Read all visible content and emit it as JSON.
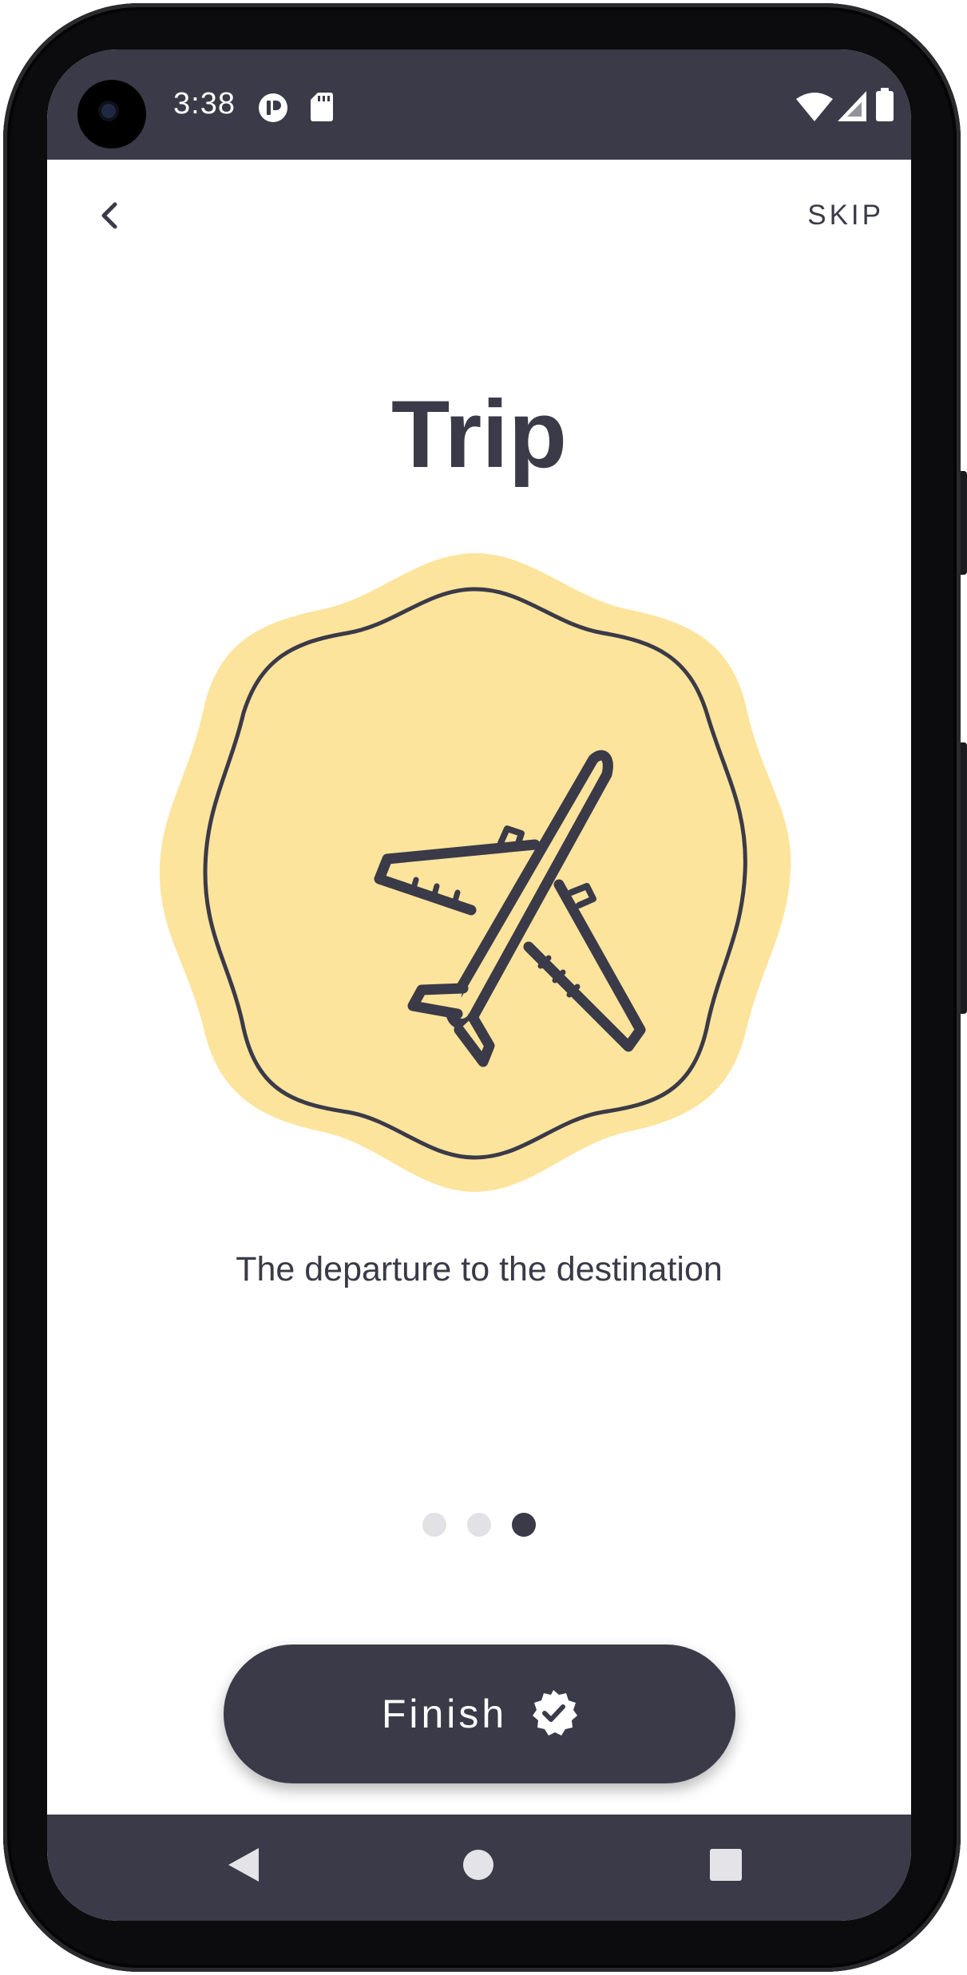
{
  "status_bar": {
    "time": "3:38",
    "icons": [
      "app-notification-icon",
      "sd-card-icon",
      "wifi-icon",
      "cell-signal-icon",
      "battery-icon"
    ]
  },
  "header": {
    "back_icon": "chevron-left-icon",
    "skip_label": "SKIP"
  },
  "onboarding": {
    "title": "Trip",
    "illustration": "airplane-badge",
    "subtitle": "The departure to the destination",
    "page_count": 3,
    "active_page": 3
  },
  "actions": {
    "finish_label": "Finish",
    "finish_icon": "verified-check-icon"
  },
  "nav_bar": {
    "icons": [
      "back-triangle-icon",
      "home-circle-icon",
      "recents-square-icon"
    ]
  },
  "colors": {
    "primary": "#3a3a48",
    "badge_fill": "#fde49c",
    "background": "#ffffff",
    "dot_inactive": "#e2e2e6"
  }
}
